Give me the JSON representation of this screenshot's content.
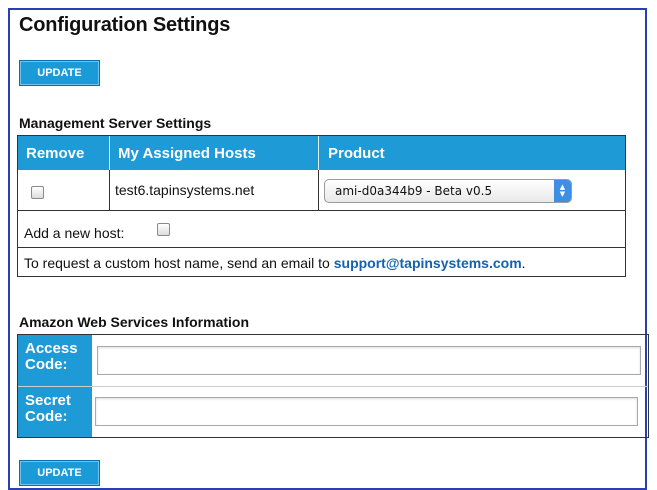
{
  "page": {
    "title": "Configuration Settings",
    "update_label": "UPDATE"
  },
  "management": {
    "section_title": "Management Server Settings",
    "columns": [
      "Remove",
      "My Assigned Hosts",
      "Product"
    ],
    "rows": [
      {
        "remove_checked": false,
        "host": "test6.tapinsystems.net",
        "product": "ami-d0a344b9 - Beta v0.5"
      }
    ],
    "add_host_label": "Add a new host:",
    "request_text": "To request a custom host name, send an email to",
    "support_email": "support@tapinsystems.com",
    "request_suffix": "."
  },
  "aws": {
    "section_title": "Amazon Web Services Information",
    "access_label_1": "Access",
    "access_label_2": "Code:",
    "access_value": "",
    "secret_label_1": "Secret",
    "secret_label_2": "Code:",
    "secret_value": ""
  },
  "colors": {
    "accent": "#1e9ad6",
    "link": "#1561b0",
    "frame": "#2b3fb4"
  }
}
